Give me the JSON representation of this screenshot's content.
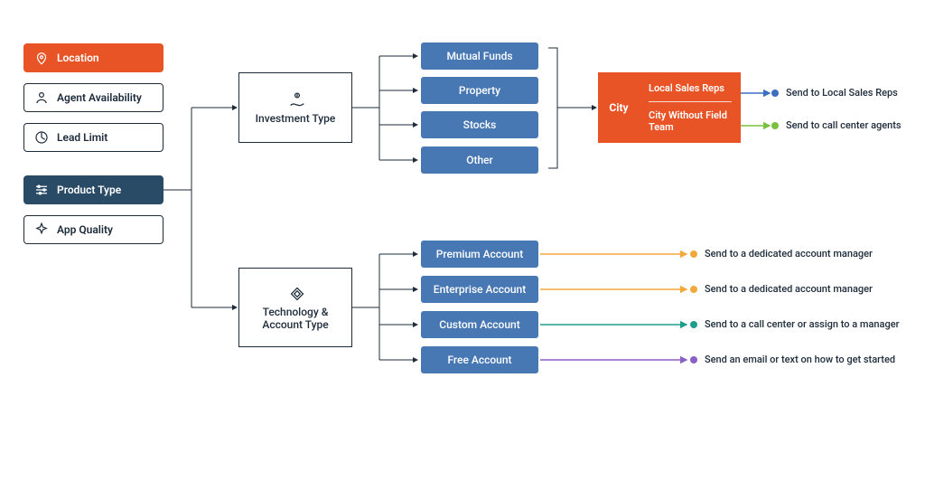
{
  "filters": {
    "location": {
      "label": "Location"
    },
    "availability": {
      "label": "Agent Availability"
    },
    "lead_limit": {
      "label": "Lead Limit"
    },
    "product_type": {
      "label": "Product Type"
    },
    "app_quality": {
      "label": "App Quality"
    }
  },
  "branches": {
    "investment": {
      "title": "Investment Type",
      "options": [
        "Mutual Funds",
        "Property",
        "Stocks",
        "Other"
      ]
    },
    "technology": {
      "title": "Technology & Account Type",
      "options": [
        "Premium Account",
        "Enterprise Account",
        "Custom Account",
        "Free Account"
      ]
    }
  },
  "city": {
    "label": "City",
    "row1": "Local Sales Reps",
    "row2": "City Without Field Team"
  },
  "actions": {
    "local_reps": "Send to Local Sales Reps",
    "call_center": "Send to call center agents",
    "premium": "Send to a dedicated account manager",
    "enterprise": "Send to a dedicated account manager",
    "custom": "Send to a call center or assign to a manager",
    "free": "Send an email or text on how to get started"
  },
  "colors": {
    "orange": "#e85426",
    "navy": "#2a4b66",
    "blue": "#4778b3",
    "line": "#1d2b3a",
    "yellow": "#f2a93b",
    "green": "#7bbf3f",
    "teal": "#1f9e8e",
    "purple": "#8a5fc7",
    "dotblue": "#3b6fbf"
  }
}
